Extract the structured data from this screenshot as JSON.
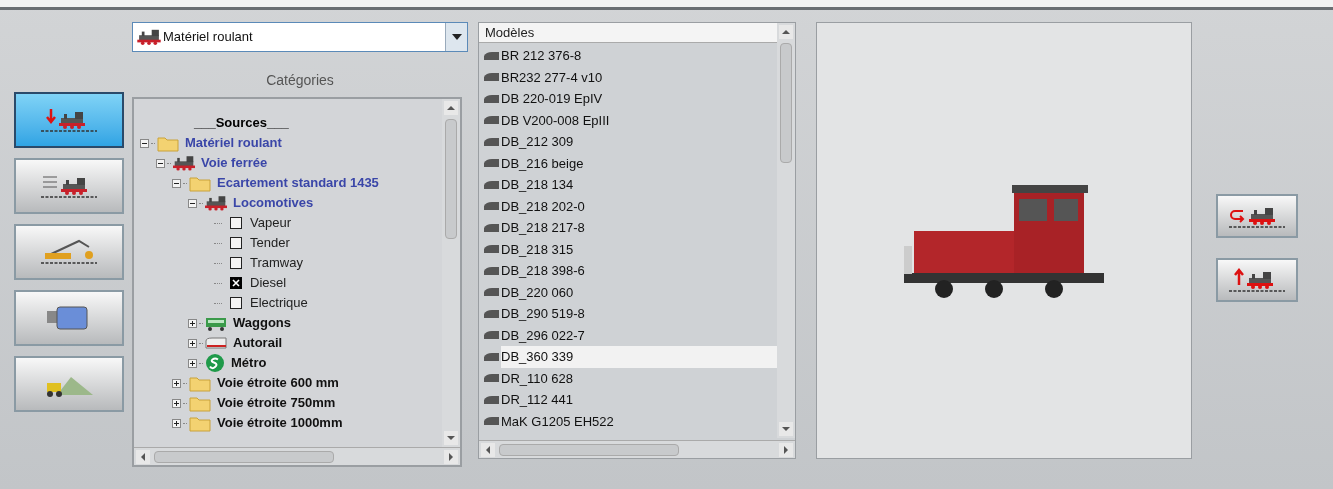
{
  "tool_buttons": [
    {
      "selected": true
    },
    {
      "selected": false
    },
    {
      "selected": false
    },
    {
      "selected": false
    },
    {
      "selected": false
    }
  ],
  "dropdown": {
    "value": "Matériel roulant"
  },
  "categories": {
    "title": "Catégories",
    "tree": [
      {
        "kind": "heading",
        "label": "___Sources___"
      },
      {
        "kind": "folder",
        "label": "Matériel roulant",
        "highlighted": true,
        "expanded": true,
        "children": [
          {
            "kind": "loco",
            "label": "Voie ferrée",
            "highlighted": true,
            "expanded": true,
            "children": [
              {
                "kind": "folder",
                "label": "Ecartement standard 1435",
                "highlighted": true,
                "expanded": true,
                "children": [
                  {
                    "kind": "loco",
                    "label": "Locomotives",
                    "highlighted": true,
                    "expanded": true,
                    "children": [
                      {
                        "kind": "checkbox",
                        "label": "Vapeur",
                        "checked": false
                      },
                      {
                        "kind": "checkbox",
                        "label": "Tender",
                        "checked": false
                      },
                      {
                        "kind": "checkbox",
                        "label": "Tramway",
                        "checked": false
                      },
                      {
                        "kind": "checkbox",
                        "label": "Diesel",
                        "checked": true
                      },
                      {
                        "kind": "checkbox",
                        "label": "Electrique",
                        "checked": false
                      }
                    ]
                  },
                  {
                    "kind": "wagon",
                    "label": "Waggons",
                    "highlighted": false,
                    "expanded": false
                  },
                  {
                    "kind": "railcar",
                    "label": "Autorail",
                    "highlighted": false,
                    "expanded": false
                  },
                  {
                    "kind": "metro",
                    "label": "Métro",
                    "highlighted": false,
                    "expanded": false
                  }
                ]
              },
              {
                "kind": "folder",
                "label": "Voie étroite 600 mm",
                "highlighted": false,
                "expanded": false
              },
              {
                "kind": "folder",
                "label": "Voie étroite 750mm",
                "highlighted": false,
                "expanded": false
              },
              {
                "kind": "folder",
                "label": "Voie étroite 1000mm",
                "highlighted": false,
                "expanded": false
              }
            ]
          }
        ]
      }
    ]
  },
  "models": {
    "header": "Modèles",
    "items": [
      {
        "label": "BR 212 376-8",
        "selected": false
      },
      {
        "label": "BR232 277-4 v10",
        "selected": false
      },
      {
        "label": "DB 220-019 EpIV",
        "selected": false
      },
      {
        "label": "DB V200-008 EpIII",
        "selected": false
      },
      {
        "label": "DB_212 309",
        "selected": false
      },
      {
        "label": "DB_216 beige",
        "selected": false
      },
      {
        "label": "DB_218 134",
        "selected": false
      },
      {
        "label": "DB_218 202-0",
        "selected": false
      },
      {
        "label": "DB_218 217-8",
        "selected": false
      },
      {
        "label": "DB_218 315",
        "selected": false
      },
      {
        "label": "DB_218 398-6",
        "selected": false
      },
      {
        "label": "DB_220 060",
        "selected": false
      },
      {
        "label": "DB_290 519-8",
        "selected": false
      },
      {
        "label": "DB_296 022-7",
        "selected": false
      },
      {
        "label": "DB_360 339",
        "selected": true
      },
      {
        "label": "DR_110 628",
        "selected": false
      },
      {
        "label": "DR_112 441",
        "selected": false
      },
      {
        "label": "MaK G1205 EH522",
        "selected": false
      }
    ]
  }
}
